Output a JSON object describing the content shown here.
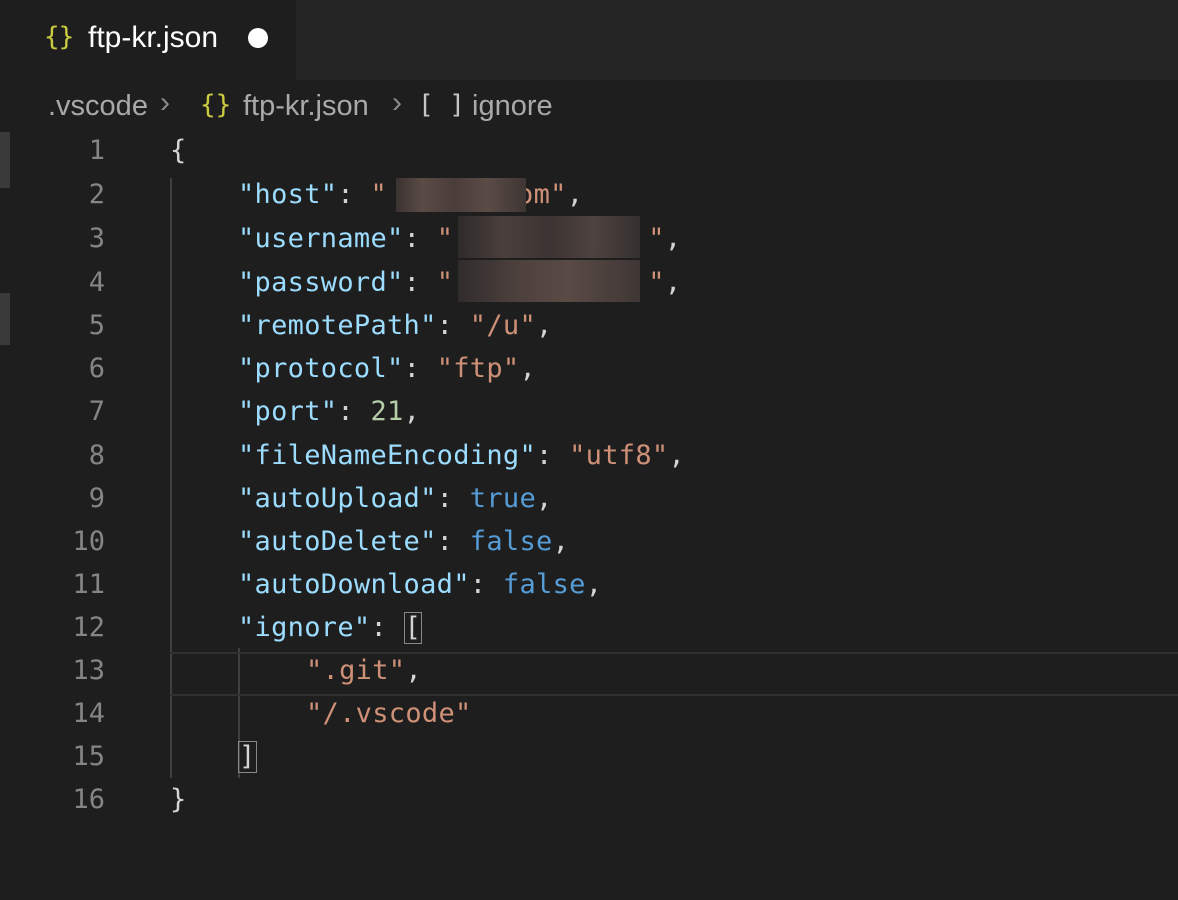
{
  "tab": {
    "icon": "{}",
    "title": "ftp-kr.json",
    "dirty": true
  },
  "breadcrumb": {
    "folder": ".vscode",
    "file_icon": "{}",
    "file": "ftp-kr.json",
    "array_icon": "[ ]",
    "symbol": "ignore"
  },
  "lines": [
    {
      "num": "1"
    },
    {
      "num": "2"
    },
    {
      "num": "3"
    },
    {
      "num": "4"
    },
    {
      "num": "5"
    },
    {
      "num": "6"
    },
    {
      "num": "7"
    },
    {
      "num": "8"
    },
    {
      "num": "9"
    },
    {
      "num": "10"
    },
    {
      "num": "11"
    },
    {
      "num": "12"
    },
    {
      "num": "13"
    },
    {
      "num": "14"
    },
    {
      "num": "15"
    },
    {
      "num": "16"
    }
  ],
  "code": {
    "open_brace": "{",
    "close_brace": "}",
    "host_key": "\"host\"",
    "host_value_visible": "om\"",
    "username_key": "\"username\"",
    "password_key": "\"password\"",
    "remotePath_key": "\"remotePath\"",
    "remotePath_value": "\"/u\"",
    "protocol_key": "\"protocol\"",
    "protocol_value": "\"ftp\"",
    "port_key": "\"port\"",
    "port_value": "21",
    "fileNameEncoding_key": "\"fileNameEncoding\"",
    "fileNameEncoding_value": "\"utf8\"",
    "autoUpload_key": "\"autoUpload\"",
    "autoUpload_value": "true",
    "autoDelete_key": "\"autoDelete\"",
    "autoDelete_value": "false",
    "autoDownload_key": "\"autoDownload\"",
    "autoDownload_value": "false",
    "ignore_key": "\"ignore\"",
    "ignore_item_1": "\".git\"",
    "ignore_item_2": "\"/.vscode\"",
    "open_bracket": "[",
    "close_bracket": "]"
  },
  "colors": {
    "key": "#9cdcfe",
    "string": "#ce9178",
    "number": "#b5cea8",
    "boolean": "#569cd6",
    "json_icon": "#cbcb41"
  }
}
